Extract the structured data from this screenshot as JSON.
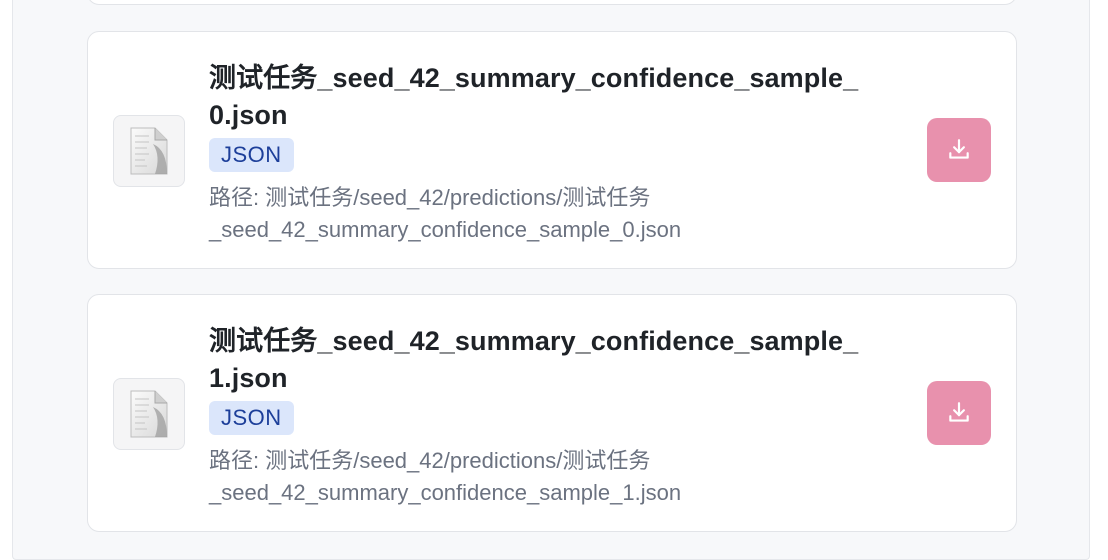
{
  "files": [
    {
      "name_line1": "测试任务_seed_42_summary_confidence_sample_",
      "name_line2": "0.json",
      "type_badge": "JSON",
      "path_line1": "路径: 测试任务/seed_42/predictions/测试任务",
      "path_line2": "_seed_42_summary_confidence_sample_0.json",
      "file_icon": "document-icon",
      "action_icon": "download-icon"
    },
    {
      "name_line1": "测试任务_seed_42_summary_confidence_sample_",
      "name_line2": "1.json",
      "type_badge": "JSON",
      "path_line1": "路径: 测试任务/seed_42/predictions/测试任务",
      "path_line2": "_seed_42_summary_confidence_sample_1.json",
      "file_icon": "document-icon",
      "action_icon": "download-icon"
    }
  ],
  "colors": {
    "download_button": "#e891ad",
    "badge_bg": "#dbe6fb",
    "badge_text": "#1d3f9a",
    "panel_bg": "#f7f8fa"
  }
}
